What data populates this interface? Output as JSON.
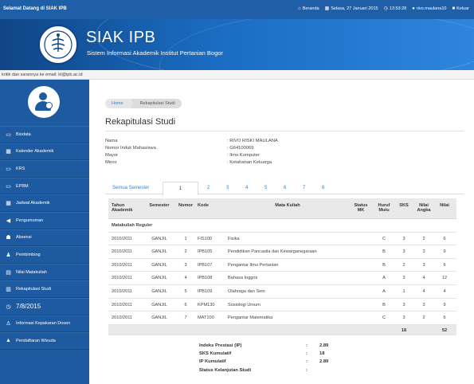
{
  "topbar": {
    "welcome": "Selamat Datang di SIAK IPB",
    "beranda": "Beranda",
    "date": "Selasa, 27 Januari 2015",
    "time": "13:53:28",
    "user": "rivo.maulana10",
    "logout": "Keluar"
  },
  "header": {
    "title": "SIAK IPB",
    "subtitle": "Sistem Informasi Akademik Institut Pertanian Bogor",
    "logo_text_top": "INSTITUT PERTANIAN",
    "logo_text_bottom": "BOGOR"
  },
  "infobar": {
    "text": "kritik dan sarannya ke email: kt@ipb.ac.id"
  },
  "sidebar": {
    "items": [
      {
        "label": "Biodata",
        "icon": "id-card-icon"
      },
      {
        "label": "Kalender Akademik",
        "icon": "calendar-icon"
      },
      {
        "label": "KRS",
        "icon": "id-card-icon"
      },
      {
        "label": "EPBM",
        "icon": "id-card-icon"
      },
      {
        "label": "Jadwal Akademik",
        "icon": "calendar-icon"
      },
      {
        "label": "Pengumuman",
        "icon": "megaphone-icon"
      },
      {
        "label": "Absensi",
        "icon": "users-icon"
      },
      {
        "label": "Pembimbing",
        "icon": "mentor-icon"
      },
      {
        "label": "Nilai Matakuliah",
        "icon": "grades-icon"
      },
      {
        "label": "Rekapitulasi Studi",
        "icon": "report-icon"
      },
      {
        "label": "7/8/2015",
        "icon": "clock-icon"
      },
      {
        "label": "Informasi Kepakaran Dosen",
        "icon": "user-icon"
      },
      {
        "label": "Pendaftaran Wisuda",
        "icon": "graduation-icon"
      }
    ]
  },
  "breadcrumb": {
    "home": "Home",
    "current": "Rekapitulasi Studi"
  },
  "page": {
    "title": "Rekapitulasi Studi"
  },
  "bio": [
    {
      "label": "Nama",
      "value": ": RIVO RISKI MAULANA"
    },
    {
      "label": "Nomor Induk Mahasiswa",
      "value": ": G64100069"
    },
    {
      "label": "Mayor",
      "value": ": Ilmu Komputer"
    },
    {
      "label": "Minor",
      "value": ": Ketahanan Keluarga"
    }
  ],
  "tabs": [
    "Semua Semester",
    "1",
    "2",
    "3",
    "4",
    "5",
    "6",
    "7",
    "8"
  ],
  "table": {
    "headers": {
      "tahun1": "Tahun",
      "tahun2": "Akademik",
      "semester": "Semester",
      "nomor": "Nomor",
      "kode": "Kode",
      "matakuliah": "Mata Kuliah",
      "status1": "Status",
      "status2": "MK",
      "huruf1": "Huruf",
      "huruf2": "Mutu",
      "sks": "SKS",
      "angka1": "Nilai",
      "angka2": "Angka",
      "nilai": "Nilai"
    },
    "group": "Matakuliah Reguler",
    "rows": [
      [
        "2010/2011",
        "GANJIL",
        "1",
        "FIS100",
        "Fisika",
        "",
        "C",
        "3",
        "2",
        "6"
      ],
      [
        "2010/2011",
        "GANJIL",
        "2",
        "IPB105",
        "Pendidikan Pancasila dan Kewarganegaraan",
        "",
        "B",
        "3",
        "3",
        "9"
      ],
      [
        "2010/2011",
        "GANJIL",
        "3",
        "IPB107",
        "Pengantar Ilmu Pertanian",
        "",
        "B",
        "2",
        "3",
        "6"
      ],
      [
        "2010/2011",
        "GANJIL",
        "4",
        "IPB108",
        "Bahasa Inggris",
        "",
        "A",
        "3",
        "4",
        "12"
      ],
      [
        "2010/2011",
        "GANJIL",
        "5",
        "IPB109",
        "Olahraga dan Seni",
        "",
        "A",
        "1",
        "4",
        "4"
      ],
      [
        "2010/2011",
        "GANJIL",
        "6",
        "KPM130",
        "Sosiologi Umum",
        "",
        "B",
        "3",
        "3",
        "9"
      ],
      [
        "2010/2011",
        "GANJIL",
        "7",
        "MAT100",
        "Pengantar Matematika",
        "",
        "C",
        "3",
        "2",
        "6"
      ]
    ],
    "total_sks": "18",
    "total_nilai": "52"
  },
  "summary": [
    {
      "label": "Indeks Prestasi (IP)",
      "value": "2.89"
    },
    {
      "label": "SKS Kumulatif",
      "value": "18"
    },
    {
      "label": "IP Kumulatif",
      "value": "2.89"
    },
    {
      "label": "Status Kelanjutan Studi",
      "value": ""
    }
  ]
}
